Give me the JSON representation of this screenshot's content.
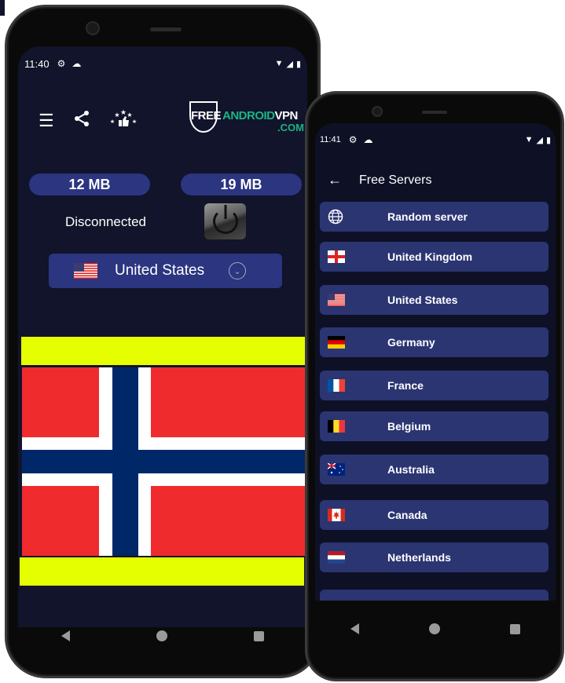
{
  "main_phone": {
    "status_bar": {
      "time": "11:40",
      "icons": [
        "gear-icon",
        "cloud-icon",
        "wifi-icon",
        "signal-icon",
        "battery-icon"
      ]
    },
    "toolbar": {
      "icons": [
        "menu-list-icon",
        "share-icon",
        "rate-stars-thumb-icon"
      ]
    },
    "logo": {
      "free": "FREE",
      "android": "ANDROID",
      "vpn": "VPN",
      "com": ".COM"
    },
    "usage": {
      "download": "12 MB",
      "upload": "19 MB"
    },
    "connection_status": "Disconnected",
    "selected_country": {
      "name": "United States",
      "flag": "us"
    },
    "banner": {
      "flag": "norway",
      "ad_bar_color": "#e6ff00"
    },
    "nav": [
      "back",
      "home",
      "recents"
    ]
  },
  "servers_phone": {
    "status_bar": {
      "time": "11:41"
    },
    "header": {
      "title": "Free Servers"
    },
    "servers": [
      {
        "name": "Random server",
        "icon": "globe"
      },
      {
        "name": "United Kingdom",
        "flag": "gb-eng"
      },
      {
        "name": "United States",
        "flag": "us"
      },
      {
        "name": "Germany",
        "flag": "de"
      },
      {
        "name": "France",
        "flag": "fr"
      },
      {
        "name": "Belgium",
        "flag": "be"
      },
      {
        "name": "Australia",
        "flag": "au"
      },
      {
        "name": "Canada",
        "flag": "ca"
      },
      {
        "name": "Netherlands",
        "flag": "nl"
      }
    ]
  },
  "colors": {
    "background": "#11142a",
    "pill": "#2b3580",
    "list_item": "#2b3572",
    "logo_green": "#19b585"
  }
}
